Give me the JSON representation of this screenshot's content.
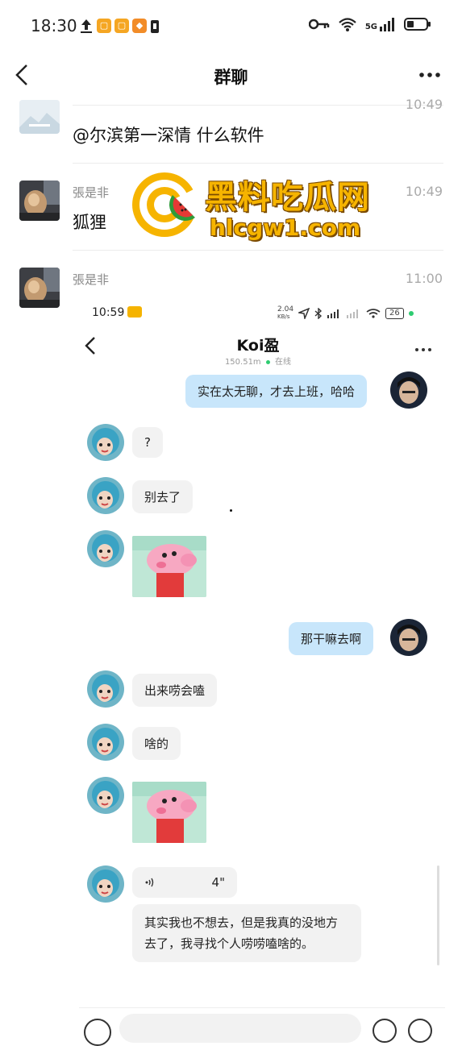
{
  "status_bar": {
    "time": "18:30",
    "network": "5G",
    "badges": [
      {
        "icon": "upload-arrow-icon",
        "color": "#222222"
      },
      {
        "icon": "app-badge-icon",
        "color": "#f5a623"
      },
      {
        "icon": "app-badge-icon",
        "color": "#f5a623"
      },
      {
        "icon": "app-badge-icon",
        "color": "#f28c28"
      },
      {
        "icon": "lock-icon",
        "color": "#222222"
      }
    ]
  },
  "header": {
    "title": "群聊",
    "back_icon": "chevron-left-icon",
    "more_icon": "more-dots-icon"
  },
  "group_messages": [
    {
      "sender": "",
      "text": "@尔滨第一深情 什么软件",
      "time": "10:49"
    },
    {
      "sender": "張是非",
      "text": "狐狸",
      "time": "10:49"
    },
    {
      "sender": "張是非",
      "text": "",
      "time": "11:00"
    }
  ],
  "watermark": {
    "title": "黑料吃瓜网",
    "url": "hlcgw1.com"
  },
  "embedded_chat": {
    "status_time": "10:59",
    "net_speed": "2.04",
    "net_unit": "KB/s",
    "battery": "26",
    "contact_name": "Koi盈",
    "distance": "150.51m",
    "online_label": "在线",
    "messages": [
      {
        "side": "right",
        "type": "text",
        "text": "实在太无聊，才去上班，哈哈"
      },
      {
        "side": "left",
        "type": "text",
        "text": "?"
      },
      {
        "side": "left",
        "type": "text",
        "text": "别去了"
      },
      {
        "side": "left",
        "type": "sticker",
        "text": ""
      },
      {
        "side": "right",
        "type": "text",
        "text": "那干嘛去啊"
      },
      {
        "side": "left",
        "type": "text",
        "text": "出来唠会嗑"
      },
      {
        "side": "left",
        "type": "text",
        "text": "啥的"
      },
      {
        "side": "left",
        "type": "sticker",
        "text": ""
      },
      {
        "side": "left",
        "type": "voice",
        "text": "4\""
      },
      {
        "side": "left",
        "type": "text",
        "text": "其实我也不想去，但是我真的没地方去了，我寻找个人唠唠嗑啥的。"
      }
    ]
  }
}
